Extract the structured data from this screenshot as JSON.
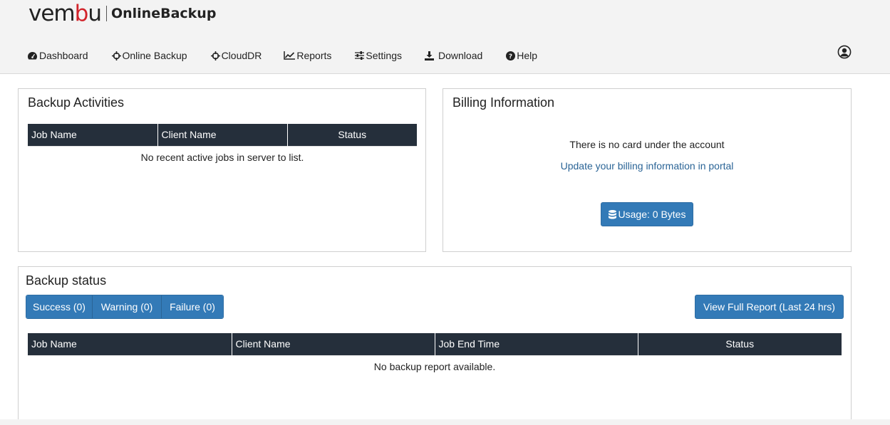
{
  "brand": {
    "logo_pre": "vem",
    "logo_red": "b",
    "logo_post": "u",
    "product": "OnlineBackup"
  },
  "nav": [
    {
      "label": "Dashboard",
      "icon": "dashboard-icon"
    },
    {
      "label": "Online Backup",
      "icon": "crosshairs-icon"
    },
    {
      "label": "CloudDR",
      "icon": "crosshairs-icon"
    },
    {
      "label": "Reports",
      "icon": "line-chart-icon"
    },
    {
      "label": "Settings",
      "icon": "sliders-icon"
    },
    {
      "label": "Download",
      "icon": "download-icon"
    },
    {
      "label": "Help",
      "icon": "question-circle-icon"
    }
  ],
  "user_icon": "user-circle-icon",
  "backup_activities": {
    "title": "Backup Activities",
    "columns": [
      "Job Name",
      "Client Name",
      "Status"
    ],
    "empty_text": "No recent active jobs in server to list."
  },
  "billing": {
    "title": "Billing Information",
    "message": "There is no card under the account",
    "link": "Update your billing information in portal",
    "usage_button": "Usage: 0 Bytes",
    "usage_icon": "database-icon"
  },
  "backup_status": {
    "title": "Backup status",
    "filters": [
      "Success (0)",
      "Warning (0)",
      "Failure (0)"
    ],
    "report_button": "View Full Report (Last 24 hrs)",
    "columns": [
      "Job Name",
      "Client Name",
      "Job End Time",
      "Status"
    ],
    "empty_text": "No backup report available."
  },
  "colors": {
    "accent": "#337ab7",
    "table_header": "#252f3b",
    "link": "#2a6496",
    "logo_red": "#d2232a"
  }
}
